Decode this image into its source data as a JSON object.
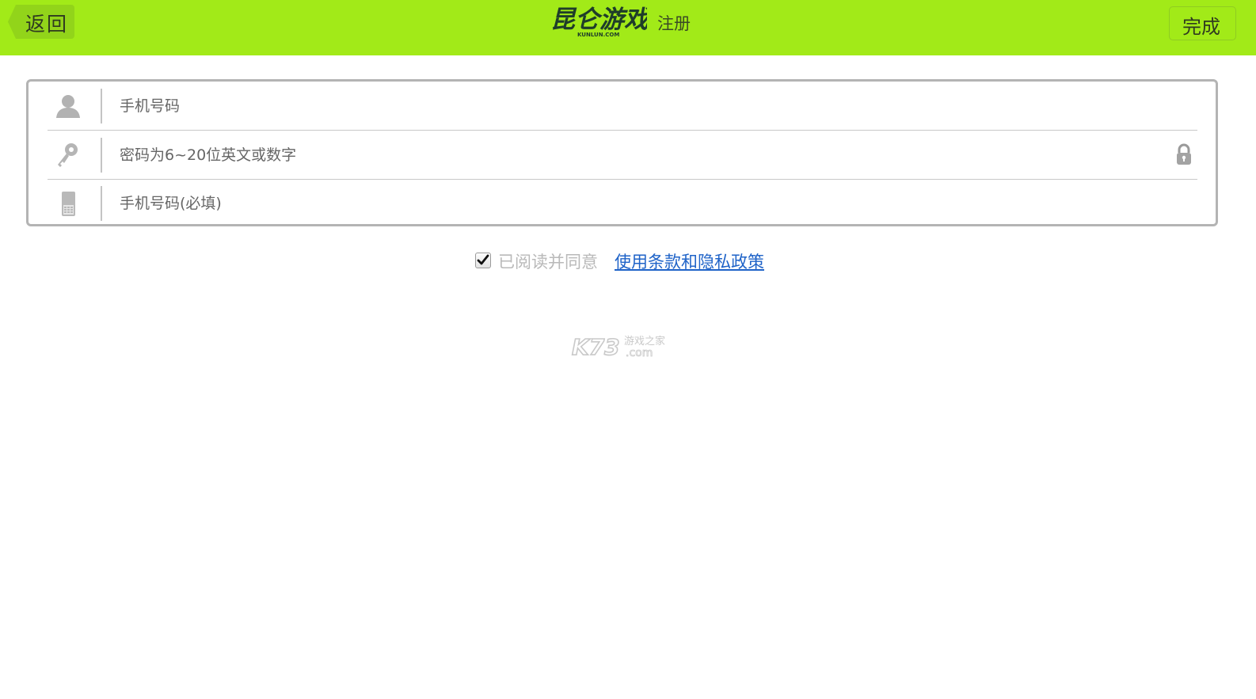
{
  "header": {
    "back_label": "返回",
    "title": "注册",
    "done_label": "完成",
    "logo_text": "昆仑游戏",
    "logo_subtext": "KUNLUN.COM",
    "bg_color": "#a2ea18"
  },
  "form": {
    "username": {
      "icon": "user-icon",
      "placeholder": "手机号码",
      "value": ""
    },
    "password": {
      "icon": "key-icon",
      "placeholder": "密码为6~20位英文或数字",
      "value": "",
      "trailing_icon": "lock-icon"
    },
    "phone": {
      "icon": "phone-icon",
      "placeholder": "手机号码(必填)",
      "value": ""
    }
  },
  "agreement": {
    "checked": true,
    "label": "已阅读并同意",
    "link_text": "使用条款和隐私政策",
    "link_color": "#1f63c8"
  },
  "watermark": {
    "text_main": "K73",
    "text_sub1": "游戏之家",
    "text_sub2": ".com"
  }
}
